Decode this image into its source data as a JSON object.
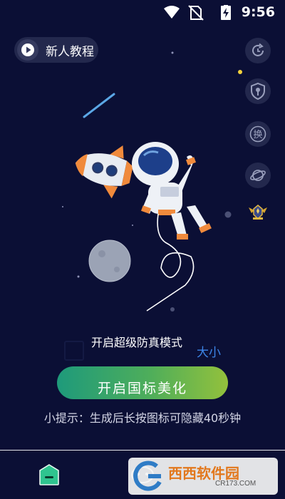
{
  "status_bar": {
    "time": "9:56",
    "icons": [
      "wifi-icon",
      "no-sim-icon",
      "battery-charging-icon"
    ]
  },
  "header": {
    "tutorial_label": "新人教程",
    "tutorial_icon": "play-icon"
  },
  "side_toolbar": {
    "items": [
      {
        "icon": "refresh-icon"
      },
      {
        "icon": "shield-lock-icon"
      },
      {
        "icon": "switch-icon",
        "glyph": "换"
      },
      {
        "icon": "planet-icon"
      },
      {
        "icon": "rank-badge-icon"
      }
    ]
  },
  "options": {
    "simulation_mode_label": "开启超级防真模式",
    "size_link": "大小"
  },
  "main_button": {
    "label": "开启国标美化"
  },
  "tip": {
    "text": "小提示：生成后长按图标可隐藏40秒钟"
  },
  "bottom_nav": {
    "items": [
      {
        "icon": "home-tab-icon",
        "active": true
      },
      {
        "icon": "game-tab-icon",
        "active": false
      }
    ]
  },
  "watermark": {
    "brand": "西西软件园",
    "site": "CR173.COM"
  },
  "colors": {
    "background": "#0b0f35",
    "accent_green": "#1e9a7b",
    "link_blue": "#3d86e8",
    "button_gradient_end": "#93c13c"
  }
}
